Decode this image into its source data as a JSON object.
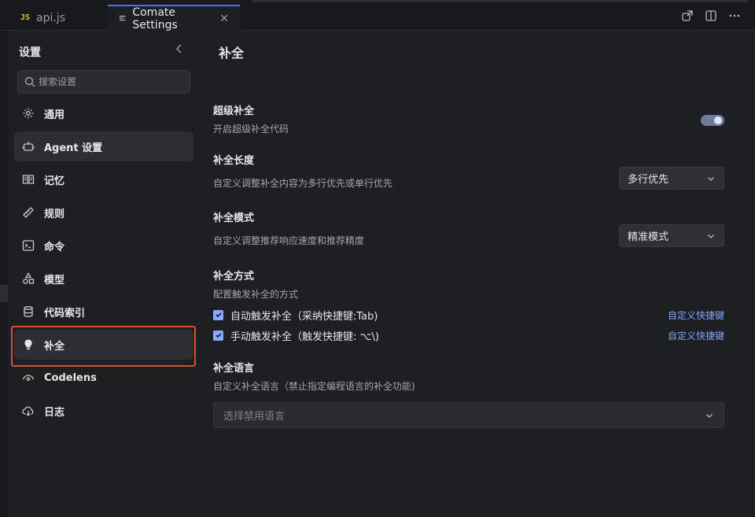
{
  "tabs": [
    {
      "badge": "JS",
      "label": "api.js",
      "active": false
    },
    {
      "label": "Comate Settings",
      "active": true
    }
  ],
  "tab_actions": [
    "new-window-icon",
    "split-editor-icon",
    "more-icon"
  ],
  "sidebar": {
    "title": "设置",
    "search_placeholder": "搜索设置",
    "items": [
      {
        "label": "通用",
        "icon": "gear-icon"
      },
      {
        "label": "Agent 设置",
        "icon": "robot-icon",
        "active": true
      },
      {
        "label": "记忆",
        "icon": "book-icon"
      },
      {
        "label": "规则",
        "icon": "ruler-icon"
      },
      {
        "label": "命令",
        "icon": "terminal-icon"
      },
      {
        "label": "模型",
        "icon": "shapes-icon"
      },
      {
        "label": "代码索引",
        "icon": "database-icon"
      },
      {
        "label": "补全",
        "icon": "bulb-icon",
        "highlighted": true
      },
      {
        "label": "Codelens",
        "icon": "eye-icon"
      },
      {
        "label": "日志",
        "icon": "cloud-icon"
      }
    ]
  },
  "main": {
    "title": "补全",
    "super_completion": {
      "title": "超级补全",
      "desc": "开启超级补全代码",
      "enabled": true
    },
    "length": {
      "title": "补全长度",
      "desc": "自定义调整补全内容为多行优先或单行优先",
      "value": "多行优先"
    },
    "mode": {
      "title": "补全模式",
      "desc": "自定义调整推荐响应速度和推荐精度",
      "value": "精准模式"
    },
    "method": {
      "title": "补全方式",
      "desc": "配置触发补全的方式",
      "options": [
        {
          "label": "自动触发补全（采纳快捷键:Tab)",
          "checked": true,
          "link": "自定义快捷键"
        },
        {
          "label": "手动触发补全（触发快捷键: ⌥\\)",
          "checked": true,
          "link": "自定义快捷键"
        }
      ]
    },
    "language": {
      "title": "补全语言",
      "desc": "自定义补全语言（禁止指定编程语言的补全功能)",
      "placeholder": "选择禁用语言"
    }
  },
  "colors": {
    "accent": "#3d77ff",
    "link": "#7fa5ff",
    "highlight_border": "#e04a2f",
    "checkbox": "#8aa8ff"
  }
}
